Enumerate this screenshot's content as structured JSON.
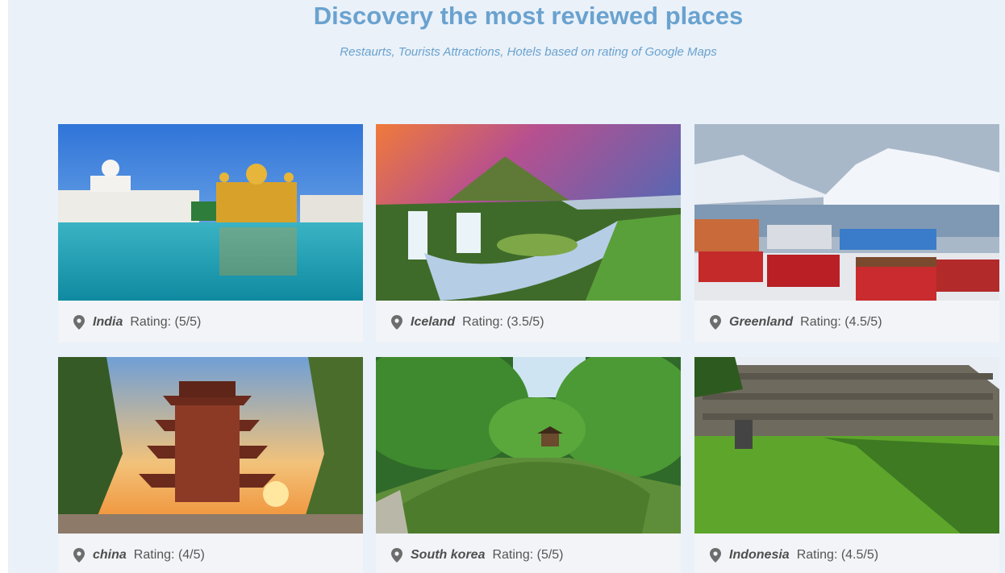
{
  "header": {
    "title": "Discovery the most reviewed places",
    "subtitle": "Restaurts, Tourists Attractions, Hotels based on rating of Google Maps"
  },
  "icons": {
    "location": "map-pin-icon"
  },
  "colors": {
    "accent": "#6aa2cf",
    "background": "#eaf1f9",
    "card": "#f2f4f7"
  },
  "cards": [
    {
      "place": "India",
      "rating": "Rating: (5/5)"
    },
    {
      "place": "Iceland",
      "rating": "Rating: (3.5/5)"
    },
    {
      "place": "Greenland",
      "rating": "Rating: (4.5/5)"
    },
    {
      "place": "china",
      "rating": "Rating: (4/5)"
    },
    {
      "place": "South korea",
      "rating": "Rating: (5/5)"
    },
    {
      "place": "Indonesia",
      "rating": "Rating: (4.5/5)"
    }
  ]
}
